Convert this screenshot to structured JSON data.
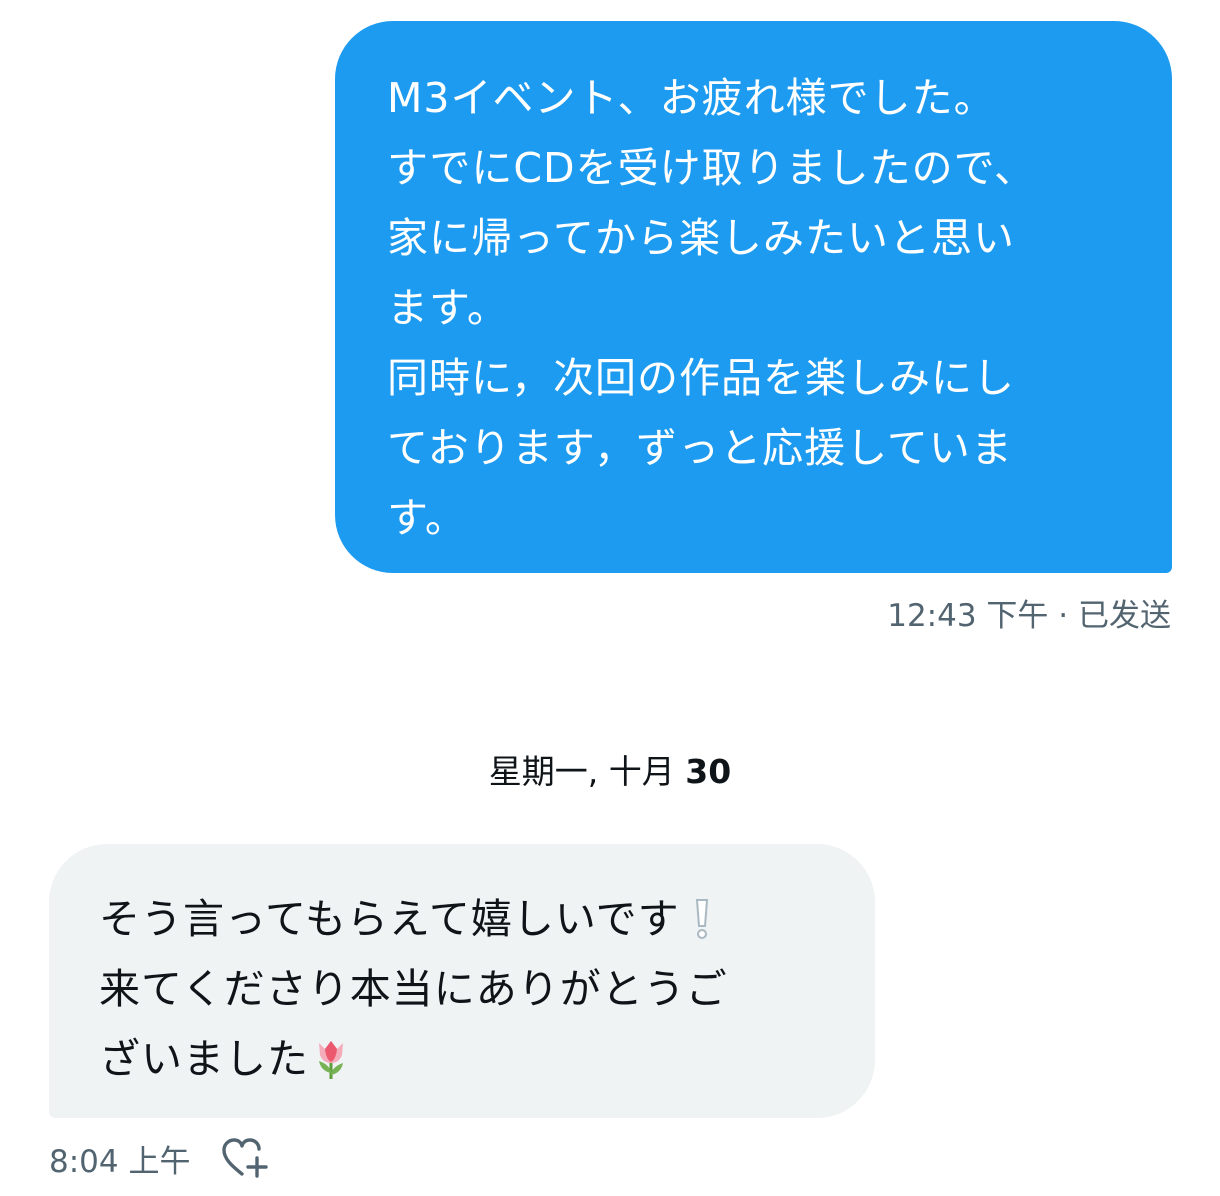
{
  "sent_message": {
    "text": "M3イベント、お疲れ様でした。\nすでにCDを受け取りましたので、\n家に帰ってから楽しみたいと思い\nます。\n同時に，次回の作品を楽しみにし\nております，ずっと応援していま\nす。",
    "timestamp": "12:43 下午 · 已发送"
  },
  "date_separator": {
    "label": "星期一, 十月",
    "day": "30"
  },
  "received_message": {
    "text_line1": "そう言ってもらえて嬉しいです",
    "text_line2": "来てくださり本当にありがとうご",
    "text_line3": "ざいました",
    "emoji_1": "white-exclamation-mark-icon",
    "emoji_2": "tulip-icon",
    "timestamp": "8:04 上午"
  },
  "icons": {
    "reaction": "heart-plus-icon"
  },
  "colors": {
    "sent_bubble": "#1d9bf0",
    "received_bubble": "#eff3f4",
    "meta_text": "#536471"
  }
}
